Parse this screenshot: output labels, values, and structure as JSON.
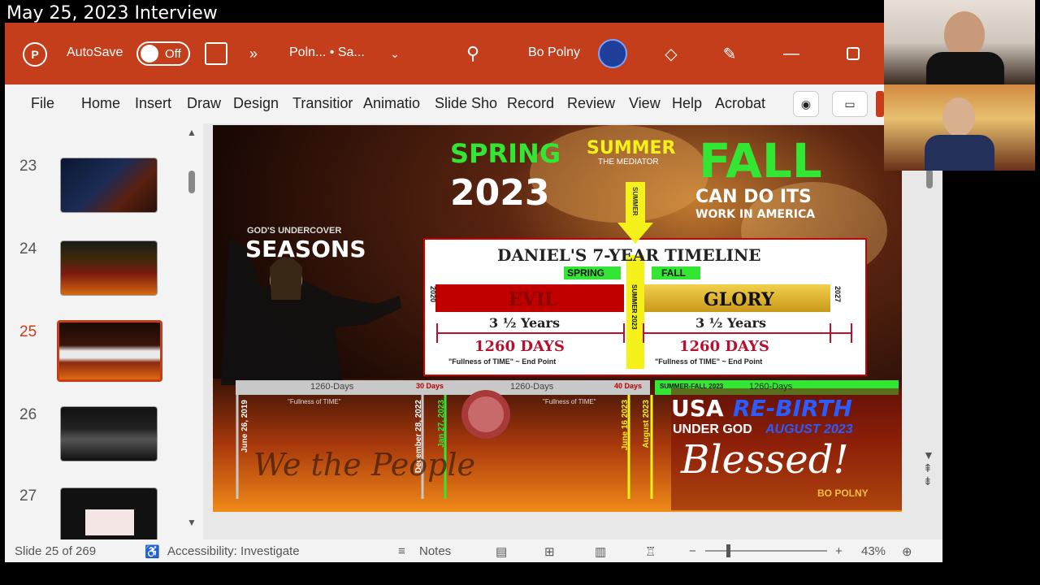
{
  "overlay": {
    "title": "May 25, 2023 Interview"
  },
  "titlebar": {
    "autosave_label": "AutoSave",
    "autosave_state": "Off",
    "doc_name": "Poln... • Sa...",
    "user_name": "Bo Polny"
  },
  "ribbon": {
    "tabs": [
      "File",
      "Home",
      "Insert",
      "Draw",
      "Design",
      "Transitior",
      "Animatio",
      "Slide Sho",
      "Record",
      "Review",
      "View",
      "Help",
      "Acrobat"
    ]
  },
  "thumbnails": [
    {
      "number": "23"
    },
    {
      "number": "24"
    },
    {
      "number": "25"
    },
    {
      "number": "26"
    },
    {
      "number": "27"
    }
  ],
  "slide": {
    "spring": "SPRING",
    "year": "2023",
    "summer": "SUMMER",
    "mediator": "THE MEDIATOR",
    "fall": "FALL",
    "fall_sub1": "CAN DO ITS",
    "fall_sub2": "WORK IN AMERICA",
    "undercover": "GOD'S UNDERCOVER",
    "seasons": "SEASONS",
    "summer_vertical": "SUMMER",
    "timeline_title": "DANIEL'S 7-YEAR TIMELINE",
    "spring_label": "SPRING",
    "fall_label": "FALL",
    "evil": "EVIL",
    "glory": "GLORY",
    "year_left": "2020",
    "year_right": "2027",
    "years_left": "3 ½ Years",
    "years_right": "3 ½ Years",
    "days_left": "1260 DAYS",
    "days_right": "1260 DAYS",
    "fullness_left": "\"Fullness of TIME\" ~ End Point",
    "fullness_right": "\"Fullness of TIME\" ~ End Point",
    "summer_2023": "SUMMER 2023",
    "bar_1260a": "1260-Days",
    "bar_30": "30 Days",
    "bar_1260b": "1260-Days",
    "bar_40": "40 Days",
    "bar_green_a": "SUMMER-FALL 2023",
    "bar_green_b": "1260-Days",
    "fullness_small_a": "\"Fullness of TIME\"",
    "fullness_small_b": "\"Fullness of TIME\"",
    "date1": "June 26, 2019",
    "date2": "December 28, 2022",
    "date3": "Jan 27, 2023",
    "date4": "June 16 2023",
    "date5": "August 2023",
    "usa": "USA",
    "rebirth": "RE-BIRTH",
    "under_god": "UNDER GOD",
    "august": "AUGUST 2023",
    "blessed": "Blessed!",
    "we_the_people": "We the People",
    "bopolny": "BO POLNY"
  },
  "statusbar": {
    "slide_info": "Slide 25 of 269",
    "accessibility": "Accessibility: Investigate",
    "notes": "Notes",
    "zoom": "43%"
  },
  "colors": {
    "brand": "#c43e1c",
    "spring_green": "#33e633",
    "summer_yellow": "#f4f21a",
    "evil_red": "#c00000",
    "glory_gold": "#e0b82a",
    "timeline_red": "#b8102e"
  }
}
